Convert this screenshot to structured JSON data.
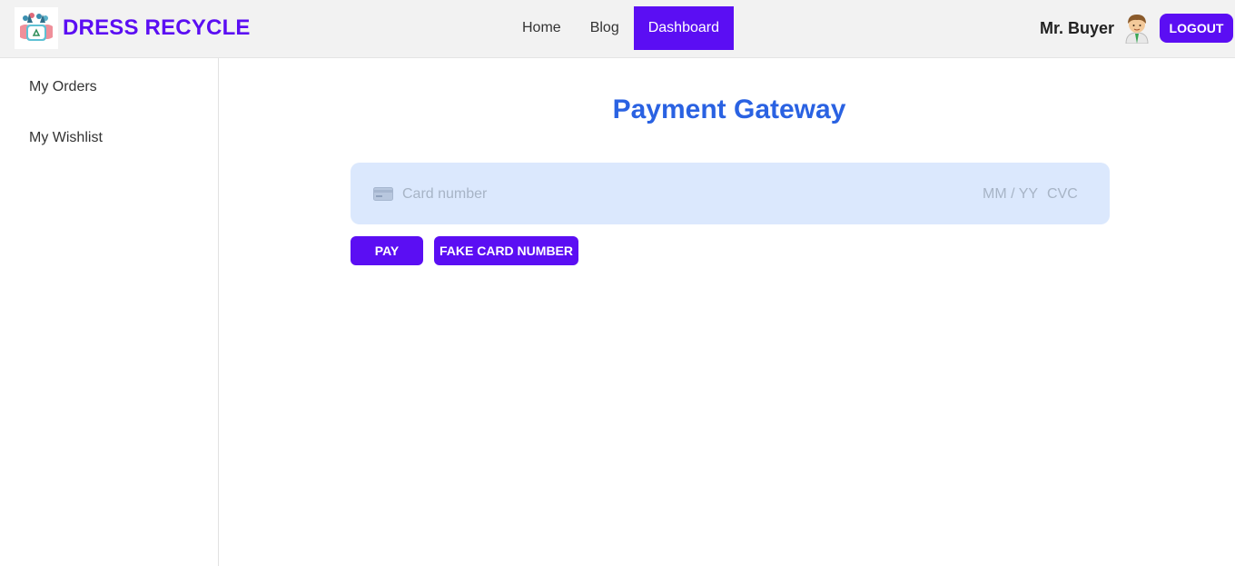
{
  "app": {
    "brand_name": "DRESS RECYCLE",
    "logo_icon": "recycle-basket-logo"
  },
  "nav": {
    "links": [
      {
        "label": "Home",
        "active": false
      },
      {
        "label": "Blog",
        "active": false
      },
      {
        "label": "Dashboard",
        "active": true
      }
    ]
  },
  "user": {
    "name": "Mr. Buyer",
    "avatar_icon": "user-avatar-icon",
    "logout_label": "LOGOUT"
  },
  "sidebar": {
    "items": [
      {
        "label": "My Orders"
      },
      {
        "label": "My Wishlist"
      }
    ]
  },
  "main": {
    "title": "Payment Gateway",
    "card_form": {
      "card_icon": "credit-card-icon",
      "card_number_placeholder": "Card number",
      "expiry_placeholder": "MM / YY",
      "cvc_placeholder": "CVC"
    },
    "pay_label": "PAY",
    "fake_card_label": "FAKE CARD NUMBER"
  },
  "colors": {
    "accent": "#5b0ef3",
    "title": "#2a62e2",
    "card_box": "#dbe8fd",
    "navbar_bg": "#f2f2f2"
  }
}
